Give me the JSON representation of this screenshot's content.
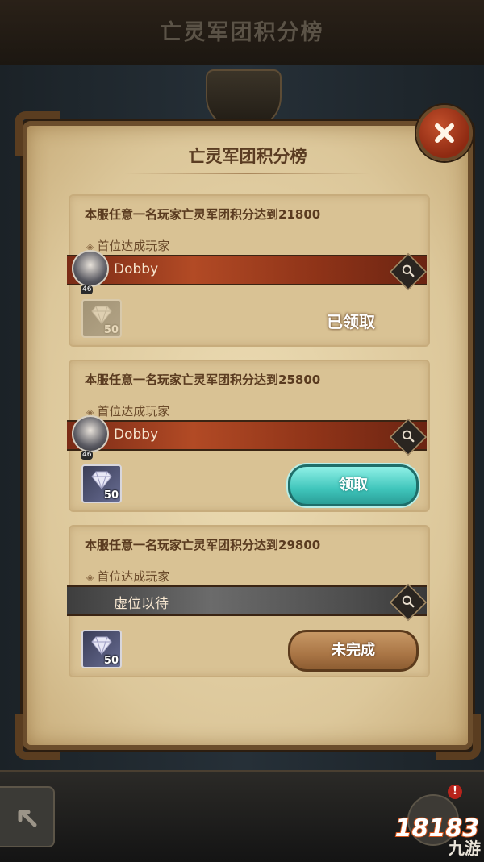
{
  "header": {
    "title": "亡灵军团积分榜"
  },
  "dialog": {
    "title": "亡灵军团积分榜"
  },
  "cards": [
    {
      "desc": "本服任意一名玩家亡灵军团积分达到21800",
      "sub": "首位达成玩家",
      "player": "Dobby",
      "level": "46",
      "reward_count": "50",
      "status": "已领取"
    },
    {
      "desc": "本服任意一名玩家亡灵军团积分达到25800",
      "sub": "首位达成玩家",
      "player": "Dobby",
      "level": "46",
      "reward_count": "50",
      "button": "领取"
    },
    {
      "desc": "本服任意一名玩家亡灵军团积分达到29800",
      "sub": "首位达成玩家",
      "player": "虚位以待",
      "reward_count": "50",
      "button": "未完成"
    }
  ],
  "alert_badge": "!",
  "watermark": {
    "number": "18183",
    "text": "九游"
  },
  "icons": {
    "close": "close-icon",
    "search": "search-icon",
    "back": "back-arrow-icon",
    "reward": "diamond-icon"
  },
  "colors": {
    "player_bar": "#b24a25",
    "empty_bar": "#6b6b6b",
    "claim_button": "#3fc5bb",
    "incomplete_button": "#a97545"
  }
}
